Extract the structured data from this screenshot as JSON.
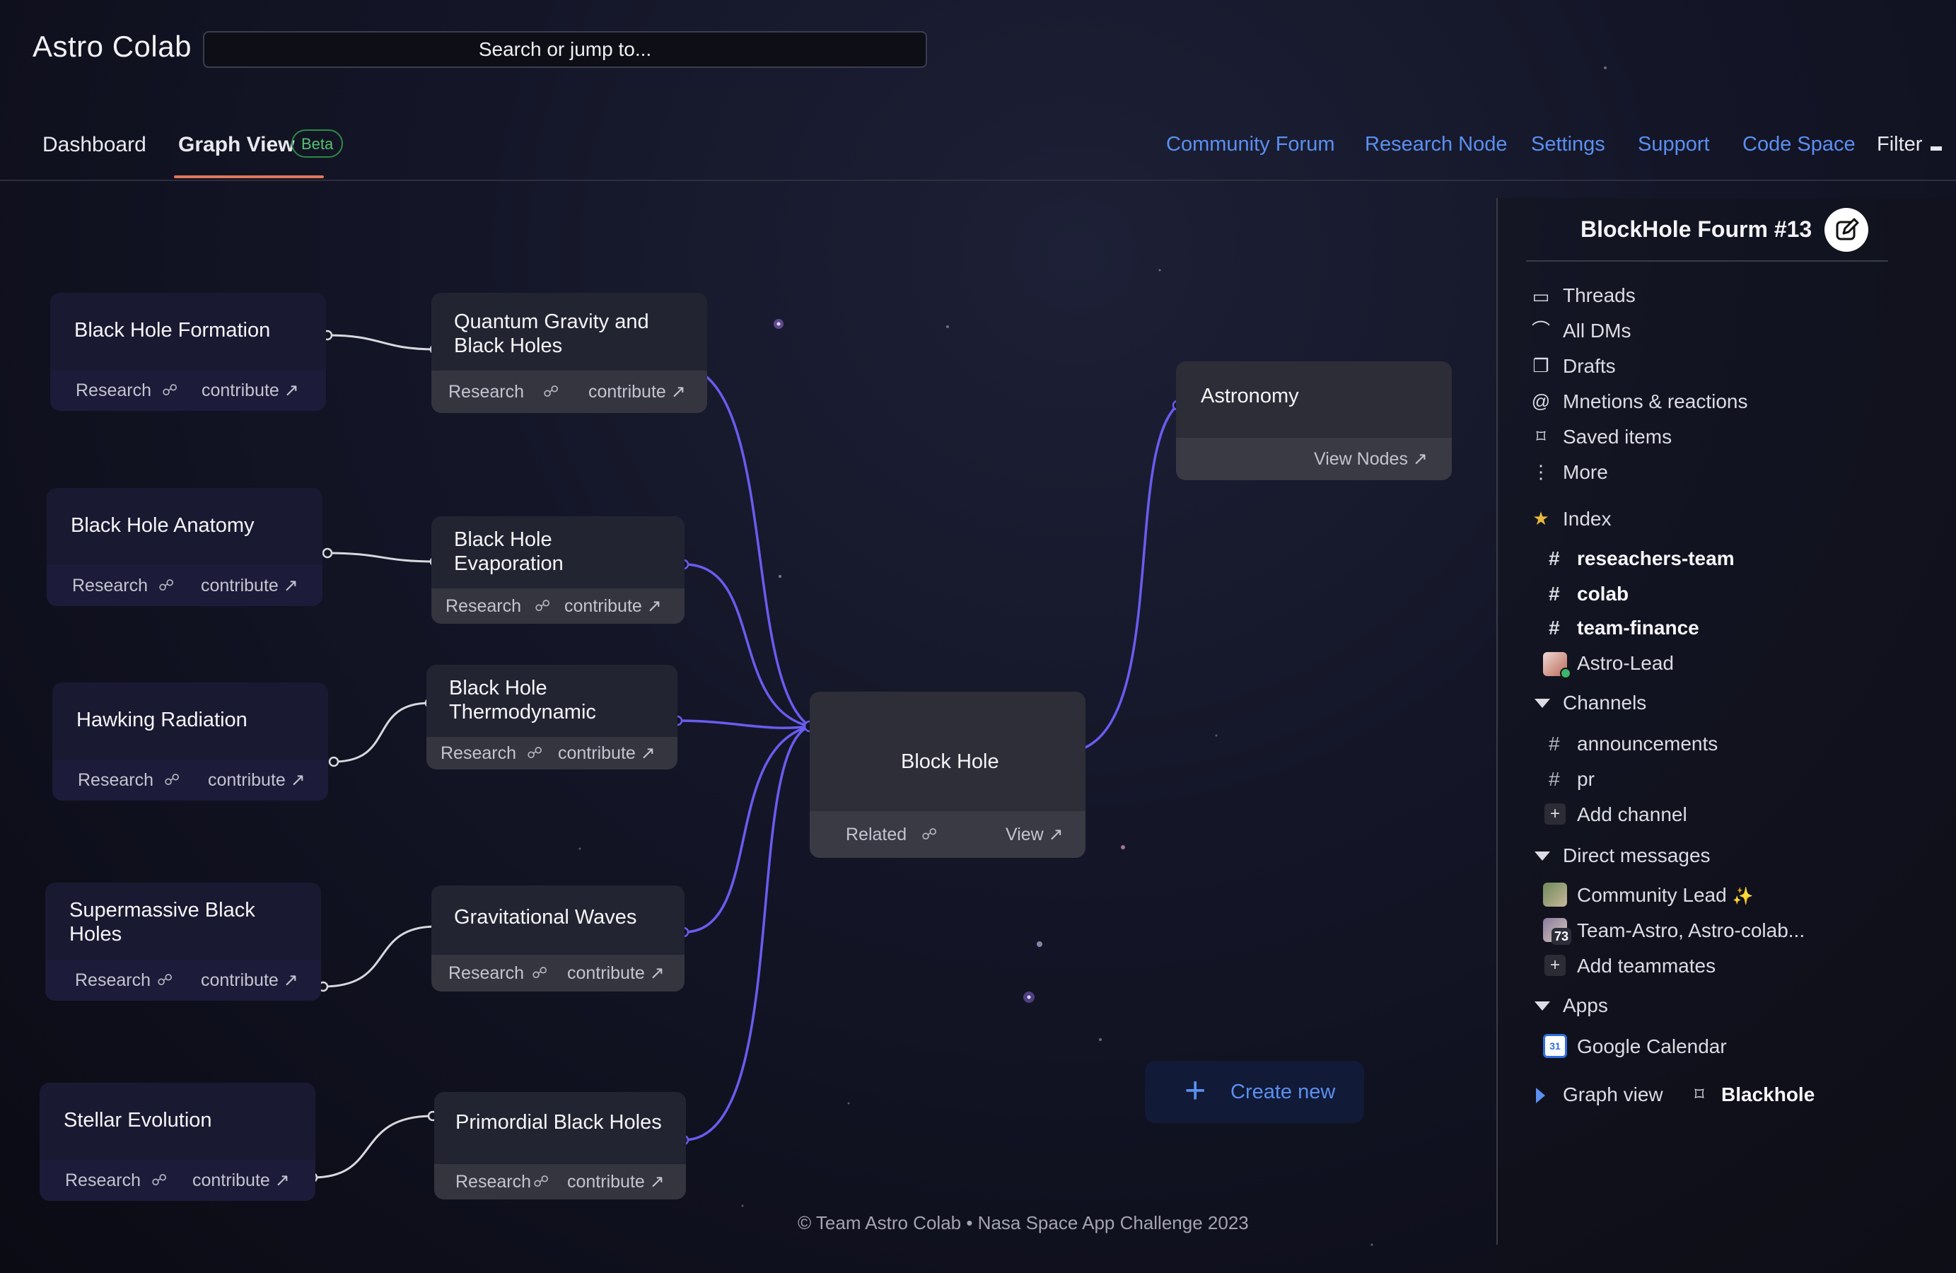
{
  "app": {
    "brand": "Astro Colab"
  },
  "search": {
    "placeholder": "Search or jump to..."
  },
  "tabs": [
    {
      "label": "Dashboard"
    },
    {
      "label": "Graph View",
      "badge": "Beta"
    }
  ],
  "nav_links": [
    "Community Forum",
    "Research Node",
    "Settings",
    "Support",
    "Code Space"
  ],
  "filter": {
    "label": "Filter"
  },
  "topic_nodes": [
    {
      "title": "Black Hole Formation",
      "tag": "Research",
      "action": "contribute ↗"
    },
    {
      "title": "Black Hole Anatomy",
      "tag": "Research",
      "action": "contribute ↗"
    },
    {
      "title": "Hawking Radiation",
      "tag": "Research",
      "action": "contribute ↗"
    },
    {
      "title": "Supermassive Black Holes",
      "tag": "Research",
      "action": "contribute ↗"
    },
    {
      "title": "Stellar Evolution",
      "tag": "Research",
      "action": "contribute ↗"
    }
  ],
  "subtopic_nodes": [
    {
      "title": "Quantum Gravity and Black Holes",
      "tag": "Research",
      "action": "contribute ↗"
    },
    {
      "title": "Black Hole Evaporation",
      "tag": "Research",
      "action": "contribute ↗"
    },
    {
      "title": "Black Hole Thermodynamic",
      "tag": "Research",
      "action": "contribute ↗"
    },
    {
      "title": "Gravitational Waves",
      "tag": "Research",
      "action": "contribute ↗"
    },
    {
      "title": "Primordial Black Holes",
      "tag": "Research",
      "action": "contribute ↗"
    }
  ],
  "center_node": {
    "title": "Block Hole",
    "tag": "Related",
    "action": "View ↗"
  },
  "astronomy_node": {
    "title": "Astronomy",
    "action": "View Nodes ↗"
  },
  "create_button": {
    "label": "Create new"
  },
  "footer": {
    "text": "© Team Astro Colab • Nasa Space App Challenge 2023"
  },
  "panel": {
    "title": "BlockHole Fourm #13",
    "menu": [
      {
        "label": "Threads",
        "icon": "threads-icon"
      },
      {
        "label": "All DMs",
        "icon": "dms-icon"
      },
      {
        "label": "Drafts",
        "icon": "drafts-icon"
      },
      {
        "label": "Mnetions & reactions",
        "icon": "at-icon"
      },
      {
        "label": "Saved items",
        "icon": "bookmark-icon"
      },
      {
        "label": "More",
        "icon": "more-icon"
      }
    ],
    "index": {
      "label": "Index",
      "items": [
        "reseachers-team",
        "colab",
        "team-finance"
      ],
      "lead": "Astro-Lead"
    },
    "channels": {
      "label": "Channels",
      "items": [
        "announcements",
        "pr"
      ],
      "add": "Add channel"
    },
    "direct_messages": {
      "label": "Direct messages",
      "items": [
        "Community Lead",
        "Team-Astro, Astro-colab..."
      ],
      "badge": "73",
      "add": "Add teammates"
    },
    "apps": {
      "label": "Apps",
      "items": [
        "Google Calendar"
      ],
      "calendar_badge": "31"
    },
    "bottom": {
      "graph_view": "Graph view",
      "saved": "Blackhole"
    }
  },
  "colors": {
    "accent": "#5b8ff0",
    "edge_active": "#6a5cf0",
    "edge_inactive": "#d8d8de",
    "tab_underline": "#e0785b",
    "beta": "#56c26f"
  }
}
